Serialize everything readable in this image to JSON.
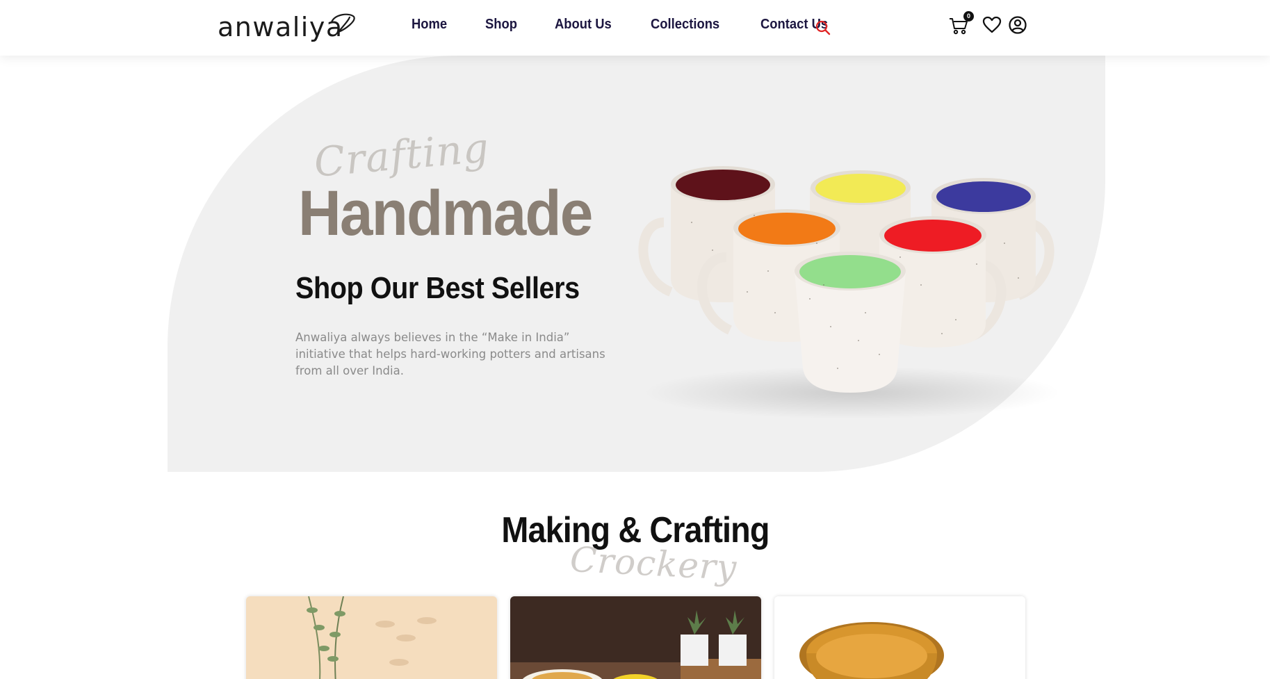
{
  "header": {
    "logo": "anwaliya",
    "nav": [
      "Home",
      "Shop",
      "About Us",
      "Collections",
      "Contact Us"
    ],
    "cart_count": "0"
  },
  "hero": {
    "script": "Crafting",
    "headline": "Handmade",
    "subheadline": "Shop Our Best Sellers",
    "description": "Anwaliya always believes in the “Make in India” initiative that helps hard-working potters and artisans from all over India."
  },
  "section": {
    "title": "Making & Crafting",
    "script": "Crockery"
  },
  "icons": {
    "search": "search-icon",
    "cart": "cart-icon",
    "wishlist": "heart-icon",
    "account": "user-icon"
  },
  "colors": {
    "nav_text": "#1c1640",
    "search_accent": "#e02424",
    "hero_bg": "#f0f0f0",
    "headline": "#8a7f74"
  }
}
